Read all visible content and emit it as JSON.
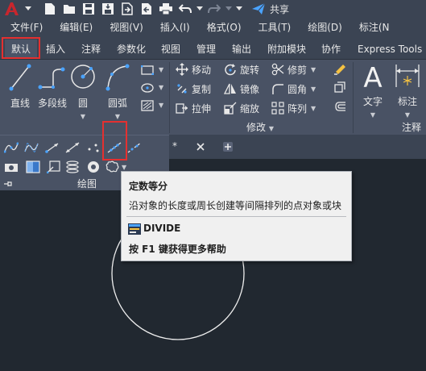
{
  "quick_access": {
    "share_label": "共享"
  },
  "menubar": {
    "items": [
      "文件(F)",
      "编辑(E)",
      "视图(V)",
      "插入(I)",
      "格式(O)",
      "工具(T)",
      "绘图(D)",
      "标注(N"
    ]
  },
  "ribbon_tabs": [
    "默认",
    "插入",
    "注释",
    "参数化",
    "视图",
    "管理",
    "输出",
    "附加模块",
    "协作",
    "Express Tools"
  ],
  "draw_panel": {
    "title": "绘图",
    "line": "直线",
    "polyline": "多段线",
    "circle": "圆",
    "arc": "圆弧"
  },
  "modify_panel": {
    "title": "修改",
    "move": "移动",
    "rotate": "旋转",
    "trim": "修剪",
    "copy": "复制",
    "mirror": "镜像",
    "fillet": "圆角",
    "stretch": "拉伸",
    "scale": "缩放",
    "array": "阵列"
  },
  "annotation_panel": {
    "title": "注释",
    "text": "文字",
    "dimension": "标注"
  },
  "file_tab": {
    "modified_marker": "*"
  },
  "tooltip": {
    "title": "定数等分",
    "description": "沿对象的长度或周长创建等间隔排列的点对象或块",
    "command": "DIVIDE",
    "help_hint": "按 F1 键获得更多帮助"
  },
  "colors": {
    "canvas": "#212830",
    "ribbon": "#495264",
    "title_bar": "#3b4453",
    "highlight": "#e43030",
    "app_red": "#c8262d",
    "accent_blue": "#4aa3ff"
  }
}
